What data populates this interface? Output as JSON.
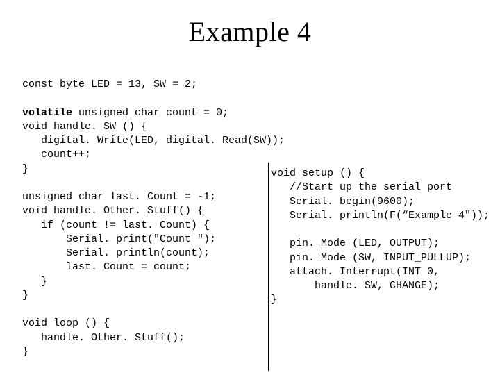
{
  "title": "Example 4",
  "code": {
    "line_const": "const byte LED = 13, SW = 2;",
    "vol_kw": "volatile",
    "vol_rest": " unsigned char count = 0;",
    "left_block": "void handle. SW () {\n   digital. Write(LED, digital. Read(SW));\n   count++;\n}\n\nunsigned char last. Count = -1;\nvoid handle. Other. Stuff() {\n   if (count != last. Count) {\n       Serial. print(\"Count \");\n       Serial. println(count);\n       last. Count = count;\n   }\n}\n\nvoid loop () {\n   handle. Other. Stuff();\n}",
    "right_block": "void setup () {\n   //Start up the serial port\n   Serial. begin(9600);\n   Serial. println(F(“Example 4\"));\n\n   pin. Mode (LED, OUTPUT);\n   pin. Mode (SW, INPUT_PULLUP);\n   attach. Interrupt(INT 0,\n       handle. SW, CHANGE);\n}"
  }
}
